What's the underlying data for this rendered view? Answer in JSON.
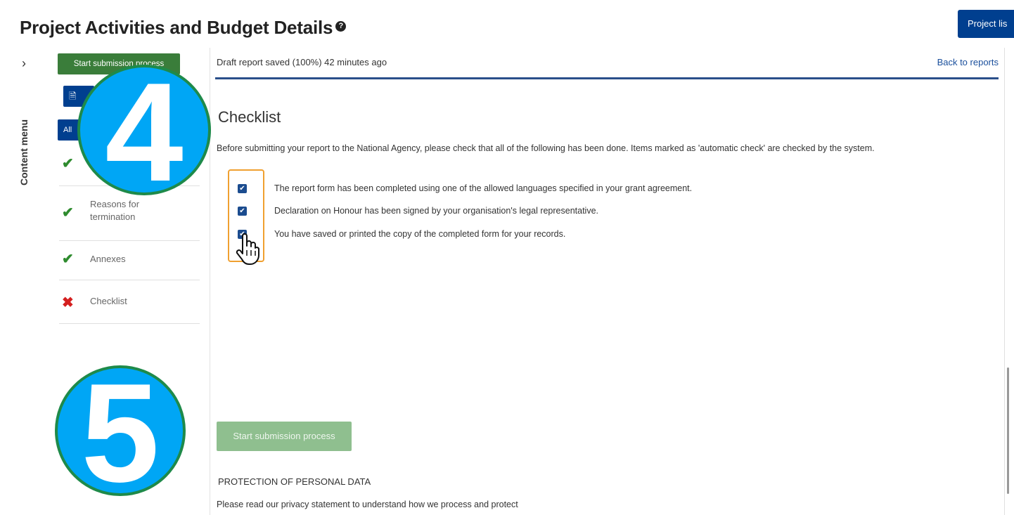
{
  "header": {
    "title": "Project Activities and Budget Details",
    "help_icon": "?",
    "project_list_label": "Project lis"
  },
  "rail": {
    "chevron": "›",
    "label": "Content menu"
  },
  "sidebar": {
    "start_submission_label": "Start submission process",
    "pdf_label": "🗎",
    "all_label": "All",
    "items": [
      {
        "label": "",
        "status": "complete"
      },
      {
        "label": "Reasons for termination",
        "status": "complete"
      },
      {
        "label": "Annexes",
        "status": "complete"
      },
      {
        "label": "Checklist",
        "status": "incomplete"
      }
    ]
  },
  "main": {
    "draft_status": "Draft report saved (100%) 42 minutes ago",
    "back_link": "Back to reports",
    "section_title": "Checklist",
    "intro": "Before submitting your report to the National Agency, please check that all of the following has been done. Items marked as 'automatic check' are checked by the system.",
    "checklist": [
      {
        "text": "The report form has been completed using one of the allowed languages specified in your grant agreement.",
        "checked": true
      },
      {
        "text": "Declaration on Honour has been signed by your organisation's legal representative.",
        "checked": true
      },
      {
        "text": "You have saved or printed the copy of the completed form for your records.",
        "checked": true
      }
    ],
    "start_submission_label": "Start submission process",
    "privacy_title": "PROTECTION OF PERSONAL DATA",
    "privacy_text": "Please read our privacy statement to understand how we process and protect"
  },
  "annotations": {
    "badge_4": "4",
    "badge_5": "5"
  },
  "colors": {
    "brand_blue": "#003f8f",
    "success_green": "#3a7d3a",
    "disabled_green": "#8fbf8f",
    "error_red": "#d42020",
    "badge_blue": "#00a6f5"
  }
}
